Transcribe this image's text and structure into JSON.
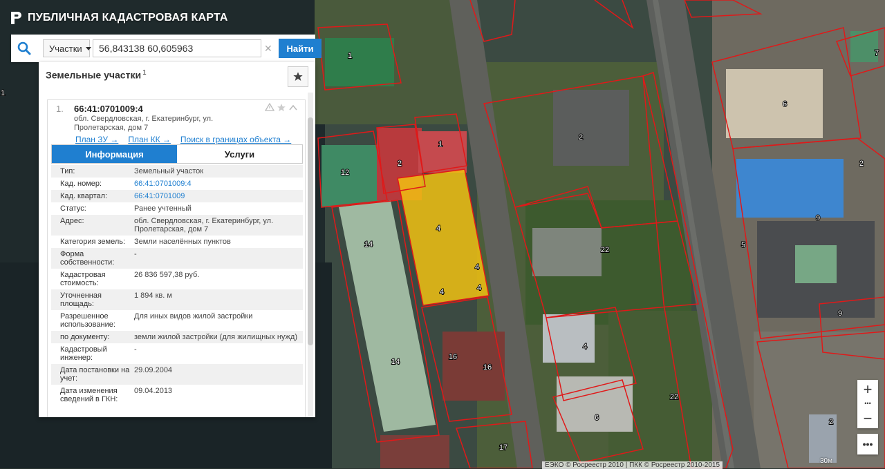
{
  "app": {
    "title": "ПУБЛИЧНАЯ КАДАСТРОВАЯ КАРТА"
  },
  "search": {
    "type_label": "Участки",
    "query": "56,843138 60,605963",
    "clear_glyph": "✕",
    "find_label": "Найти"
  },
  "panel": {
    "heading": "Земельные участки",
    "count": "1",
    "result": {
      "num": "1.",
      "cad_number": "66:41:0701009:4",
      "address": "обл. Свердловская, г. Екатеринбург, ул. Пролетарская, дом 7",
      "links": [
        "План ЗУ →",
        "План КК →",
        "Поиск в границах объекта →"
      ],
      "tabs": [
        "Информация",
        "Услуги"
      ],
      "info": [
        {
          "k": "Тип:",
          "v": "Земельный участок"
        },
        {
          "k": "Кад. номер:",
          "v": "66:41:0701009:4"
        },
        {
          "k": "Кад. квартал:",
          "v": "66:41:0701009"
        },
        {
          "k": "Статус:",
          "v": "Ранее учтенный"
        },
        {
          "k": "Адрес:",
          "v": "обл. Свердловская, г. Екатеринбург, ул. Пролетарская, дом 7"
        },
        {
          "k": "Категория земель:",
          "v": "Земли населённых пунктов"
        },
        {
          "k": "Форма собственности:",
          "v": "-"
        },
        {
          "k": "Кадастровая стоимость:",
          "v": "26 836 597,38 руб."
        },
        {
          "k": "Уточненная площадь:",
          "v": "1 894 кв. м"
        },
        {
          "k": "Разрешенное использование:",
          "v": "Для иных видов жилой застройки"
        },
        {
          "k": "по документу:",
          "v": "земли жилой застройки (для жилищных нужд)"
        },
        {
          "k": "Кадастровый инженер:",
          "v": "-"
        },
        {
          "k": "Дата постановки на учет:",
          "v": "29.09.2004"
        },
        {
          "k": "Дата изменения сведений в ГКН:",
          "v": "09.04.2013"
        }
      ]
    }
  },
  "map": {
    "attribution": "ЕЭКО © Росреестр 2010 | ПКК © Росреестр 2010-2015",
    "scale": "30м",
    "zoom_in": "+",
    "zoom_out": "−",
    "more": "•••",
    "colors": {
      "parcel_border": "#e01919",
      "selected_fill": "#f2c20f"
    },
    "labels": [
      "1",
      "1",
      "1",
      "2",
      "2",
      "2",
      "2",
      "4",
      "4",
      "4",
      "4",
      "4",
      "5",
      "6",
      "6",
      "7",
      "9",
      "9",
      "12",
      "14",
      "14",
      "16",
      "16",
      "17",
      "22",
      "22"
    ]
  }
}
